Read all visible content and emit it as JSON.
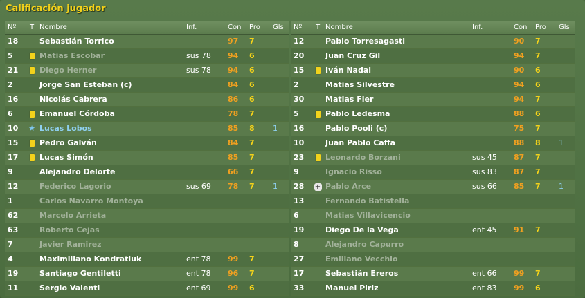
{
  "title": "Calificación jugador",
  "headers": {
    "num": "Nº",
    "t": "T",
    "name": "Nombre",
    "inf": "Inf.",
    "con": "Con",
    "pro": "Pro",
    "gls": "Gls"
  },
  "left": [
    {
      "num": "18",
      "icon": "",
      "name": "Sebastián Torrico",
      "inf": "",
      "con": "97",
      "pro": "7",
      "gls": "",
      "dim": false
    },
    {
      "num": "5",
      "icon": "yellow-card",
      "name": "Matias Escobar",
      "inf": "sus 78",
      "con": "94",
      "pro": "6",
      "gls": "",
      "dim": true
    },
    {
      "num": "21",
      "icon": "yellow-card",
      "name": "Diego Herner",
      "inf": "sus 78",
      "con": "94",
      "pro": "6",
      "gls": "",
      "dim": true
    },
    {
      "num": "2",
      "icon": "",
      "name": "Jorge San Esteban (c)",
      "inf": "",
      "con": "84",
      "pro": "6",
      "gls": "",
      "dim": false
    },
    {
      "num": "16",
      "icon": "",
      "name": "Nicolás Cabrera",
      "inf": "",
      "con": "86",
      "pro": "6",
      "gls": "",
      "dim": false
    },
    {
      "num": "6",
      "icon": "yellow-card",
      "name": "Emanuel Córdoba",
      "inf": "",
      "con": "78",
      "pro": "7",
      "gls": "",
      "dim": false
    },
    {
      "num": "10",
      "icon": "star",
      "name": "Lucas Lobos",
      "inf": "",
      "con": "85",
      "pro": "8",
      "gls": "1",
      "dim": false,
      "star": true
    },
    {
      "num": "15",
      "icon": "yellow-card",
      "name": "Pedro Galván",
      "inf": "",
      "con": "84",
      "pro": "7",
      "gls": "",
      "dim": false
    },
    {
      "num": "17",
      "icon": "yellow-card",
      "name": "Lucas Simón",
      "inf": "",
      "con": "85",
      "pro": "7",
      "gls": "",
      "dim": false
    },
    {
      "num": "9",
      "icon": "",
      "name": "Alejandro Delorte",
      "inf": "",
      "con": "66",
      "pro": "7",
      "gls": "",
      "dim": false
    },
    {
      "num": "12",
      "icon": "",
      "name": "Federico Lagorio",
      "inf": "sus 69",
      "con": "78",
      "pro": "7",
      "gls": "1",
      "dim": true
    },
    {
      "num": "1",
      "icon": "",
      "name": "Carlos Navarro Montoya",
      "inf": "",
      "con": "",
      "pro": "",
      "gls": "",
      "dim": true
    },
    {
      "num": "62",
      "icon": "",
      "name": "Marcelo Arrieta",
      "inf": "",
      "con": "",
      "pro": "",
      "gls": "",
      "dim": true
    },
    {
      "num": "63",
      "icon": "",
      "name": "Roberto Cejas",
      "inf": "",
      "con": "",
      "pro": "",
      "gls": "",
      "dim": true
    },
    {
      "num": "7",
      "icon": "",
      "name": "Javier Ramirez",
      "inf": "",
      "con": "",
      "pro": "",
      "gls": "",
      "dim": true
    },
    {
      "num": "4",
      "icon": "",
      "name": "Maximiliano Kondratiuk",
      "inf": "ent 78",
      "con": "99",
      "pro": "7",
      "gls": "",
      "dim": false
    },
    {
      "num": "19",
      "icon": "",
      "name": "Santiago Gentiletti",
      "inf": "ent 78",
      "con": "96",
      "pro": "7",
      "gls": "",
      "dim": false
    },
    {
      "num": "11",
      "icon": "",
      "name": "Sergio Valenti",
      "inf": "ent 69",
      "con": "99",
      "pro": "6",
      "gls": "",
      "dim": false
    }
  ],
  "right": [
    {
      "num": "12",
      "icon": "",
      "name": "Pablo Torresagasti",
      "inf": "",
      "con": "90",
      "pro": "7",
      "gls": "",
      "dim": false
    },
    {
      "num": "20",
      "icon": "",
      "name": "Juan Cruz Gil",
      "inf": "",
      "con": "94",
      "pro": "7",
      "gls": "",
      "dim": false
    },
    {
      "num": "15",
      "icon": "yellow-card",
      "name": "Iván Nadal",
      "inf": "",
      "con": "90",
      "pro": "6",
      "gls": "",
      "dim": false
    },
    {
      "num": "2",
      "icon": "",
      "name": "Matias Silvestre",
      "inf": "",
      "con": "94",
      "pro": "6",
      "gls": "",
      "dim": false
    },
    {
      "num": "30",
      "icon": "",
      "name": "Matias Fler",
      "inf": "",
      "con": "94",
      "pro": "7",
      "gls": "",
      "dim": false
    },
    {
      "num": "5",
      "icon": "yellow-card",
      "name": "Pablo Ledesma",
      "inf": "",
      "con": "88",
      "pro": "6",
      "gls": "",
      "dim": false
    },
    {
      "num": "16",
      "icon": "",
      "name": "Pablo Pooli (c)",
      "inf": "",
      "con": "75",
      "pro": "7",
      "gls": "",
      "dim": false
    },
    {
      "num": "10",
      "icon": "",
      "name": "Juan Pablo Caffa",
      "inf": "",
      "con": "88",
      "pro": "8",
      "gls": "1",
      "dim": false
    },
    {
      "num": "23",
      "icon": "yellow-card",
      "name": "Leonardo Borzani",
      "inf": "sus 45",
      "con": "87",
      "pro": "7",
      "gls": "",
      "dim": true
    },
    {
      "num": "9",
      "icon": "",
      "name": "Ignacio Risso",
      "inf": "sus 83",
      "con": "87",
      "pro": "7",
      "gls": "",
      "dim": true
    },
    {
      "num": "28",
      "icon": "injury",
      "name": "Pablo Arce",
      "inf": "sus 66",
      "con": "85",
      "pro": "7",
      "gls": "1",
      "dim": true
    },
    {
      "num": "13",
      "icon": "",
      "name": "Fernando Batistella",
      "inf": "",
      "con": "",
      "pro": "",
      "gls": "",
      "dim": true
    },
    {
      "num": "6",
      "icon": "",
      "name": "Matias Villavicencio",
      "inf": "",
      "con": "",
      "pro": "",
      "gls": "",
      "dim": true
    },
    {
      "num": "19",
      "icon": "",
      "name": "Diego De la Vega",
      "inf": "ent 45",
      "con": "91",
      "pro": "7",
      "gls": "",
      "dim": false
    },
    {
      "num": "8",
      "icon": "",
      "name": "Alejandro Capurro",
      "inf": "",
      "con": "",
      "pro": "",
      "gls": "",
      "dim": true
    },
    {
      "num": "27",
      "icon": "",
      "name": "Emiliano Vecchio",
      "inf": "",
      "con": "",
      "pro": "",
      "gls": "",
      "dim": true
    },
    {
      "num": "17",
      "icon": "",
      "name": "Sebastián Ereros",
      "inf": "ent 66",
      "con": "99",
      "pro": "7",
      "gls": "",
      "dim": false
    },
    {
      "num": "33",
      "icon": "",
      "name": "Manuel Piriz",
      "inf": "ent 83",
      "con": "99",
      "pro": "6",
      "gls": "",
      "dim": false
    }
  ]
}
